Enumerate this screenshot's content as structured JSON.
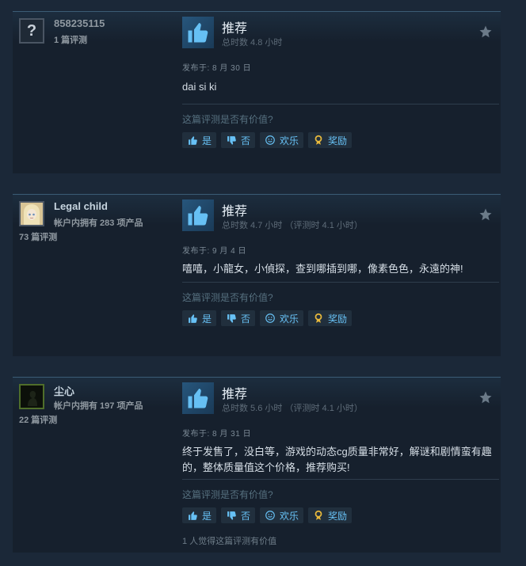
{
  "common": {
    "verdict": "推荐",
    "helpful_question": "这篇评测是否有价值?",
    "btn_yes": "是",
    "btn_no": "否",
    "btn_funny": "欢乐",
    "btn_award": "奖励"
  },
  "reviews": [
    {
      "username": "858235115",
      "reviews_count": "1 篇评测",
      "hours": "总时数 4.8 小时",
      "posted": "发布于: 8 月 30 日",
      "text": "dai si ki"
    },
    {
      "username": "Legal child",
      "products_owned": "帐户内拥有 283 项产品",
      "reviews_count": "73 篇评测",
      "hours": "总时数 4.7 小时  （评测时 4.1 小时）",
      "posted": "发布于: 9 月 4 日",
      "text": "嘻嘻，小龍女，小偵探，查到哪插到哪，像素色色，永遠的神!"
    },
    {
      "username": "尘心",
      "products_owned": "帐户内拥有 197 项产品",
      "reviews_count": "22 篇评测",
      "hours": "总时数 5.6 小时  （评测时 4.1 小时）",
      "posted": "发布于: 8 月 31 日",
      "text": "终于发售了，没白等，游戏的动态cg质量非常好，解谜和剧情蛮有趣的，整体质量值这个价格，推荐购买!",
      "helpful_note": "1 人觉得这篇评测有价值"
    }
  ],
  "colors": {
    "page_bg": "#1b2838",
    "card_bg": "#16202d",
    "link_blue": "#67c1f5"
  },
  "icons": [
    "question-mark-icon",
    "thumbs-up-icon",
    "thumbs-down-icon",
    "smiley-icon",
    "award-icon",
    "star-icon"
  ]
}
